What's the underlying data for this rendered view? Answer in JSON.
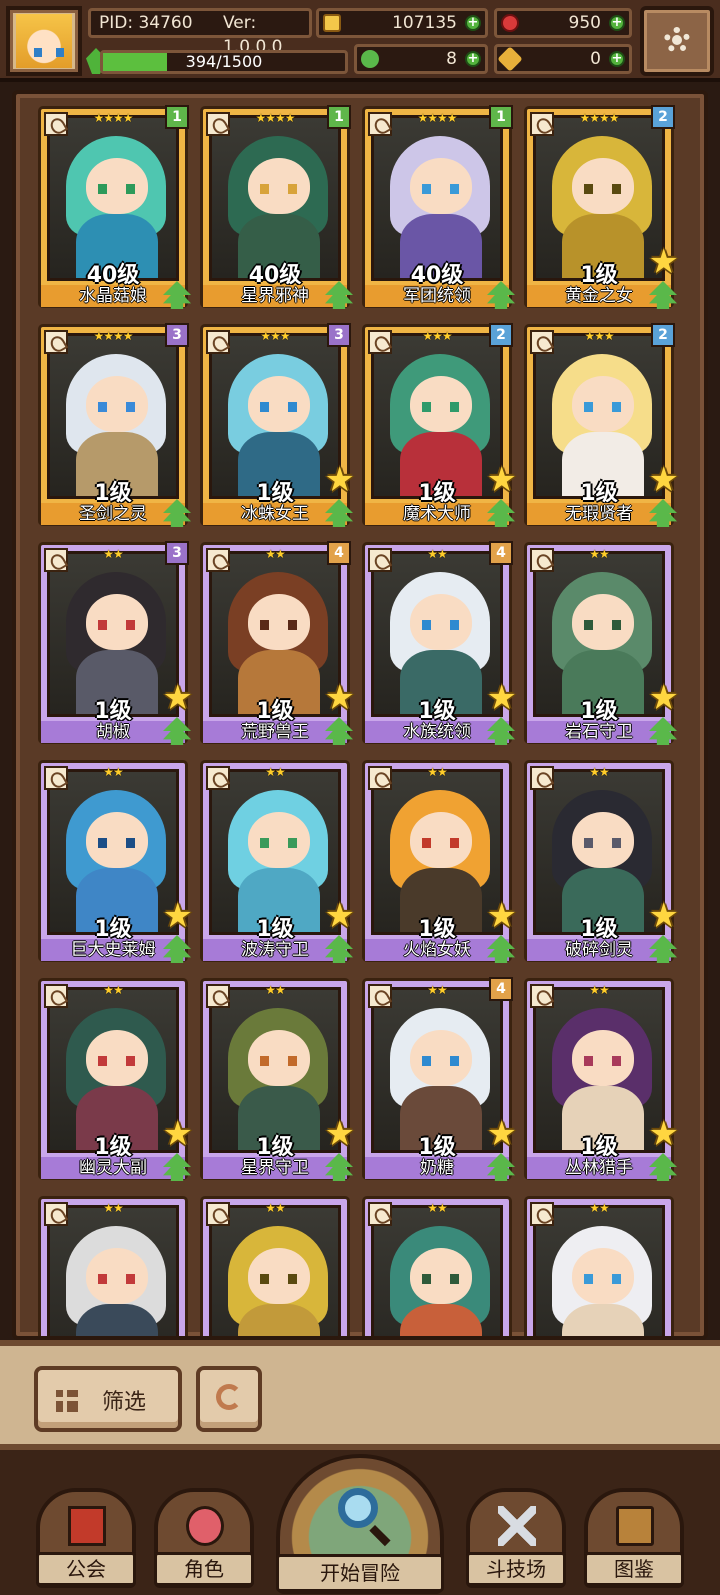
{
  "player": {
    "pid": "PID: 34760",
    "version": "Ver: 1.0.0.0",
    "xp_text": "394/1500",
    "xp_progress": 0.263
  },
  "currencies": {
    "gold": "107135",
    "gems": "950",
    "clovers": "8",
    "keys": "0"
  },
  "colors": {
    "hud_bg": "#4a2d1e",
    "gold_card": "#f0b545",
    "purple_card": "#c9a6ea",
    "xp_fill": "#5cbf3e"
  },
  "cards": [
    {
      "name": "水晶菇娘",
      "level": "40级",
      "stars": "★★★★",
      "rank": "1",
      "rarity": "gold",
      "star_badge": false,
      "hair": "#4fc6b0",
      "body": "#2d8fb3",
      "eye": "#2d9a5a"
    },
    {
      "name": "星界邪神",
      "level": "40级",
      "stars": "★★★★",
      "rank": "1",
      "rarity": "gold",
      "star_badge": false,
      "hair": "#2d6a52",
      "body": "#355e48",
      "eye": "#d8a33a"
    },
    {
      "name": "军团统领",
      "level": "40级",
      "stars": "★★★★",
      "rank": "1",
      "rarity": "gold",
      "star_badge": false,
      "hair": "#cdc6e8",
      "body": "#6a56a6",
      "eye": "#3a9ad8"
    },
    {
      "name": "黄金之女",
      "level": "1级",
      "stars": "★★★★",
      "rank": "2",
      "rarity": "gold",
      "star_badge": true,
      "hair": "#d8b63a",
      "body": "#b8922a",
      "eye": "#5a4a10"
    },
    {
      "name": "圣剑之灵",
      "level": "1级",
      "stars": "★★★★",
      "rank": "3",
      "rarity": "gold",
      "star_badge": false,
      "hair": "#dfe6ee",
      "body": "#b69a6a",
      "eye": "#3a8ad8"
    },
    {
      "name": "冰蛛女王",
      "level": "1级",
      "stars": "★★★",
      "rank": "3",
      "rarity": "gold",
      "star_badge": true,
      "hair": "#79cde0",
      "body": "#2f6a86",
      "eye": "#2f8ad0"
    },
    {
      "name": "魔术大师",
      "level": "1级",
      "stars": "★★★",
      "rank": "2",
      "rarity": "gold",
      "star_badge": true,
      "hair": "#3f9a7a",
      "body": "#b8303a",
      "eye": "#2f9a6a"
    },
    {
      "name": "无瑕贤者",
      "level": "1级",
      "stars": "★★★",
      "rank": "2",
      "rarity": "gold",
      "star_badge": true,
      "hair": "#f6dd8a",
      "body": "#f2ece6",
      "eye": "#3a9ad8"
    },
    {
      "name": "胡椒",
      "level": "1级",
      "stars": "★★",
      "rank": "3",
      "rarity": "purple",
      "star_badge": true,
      "hair": "#2f2a2e",
      "body": "#595a68",
      "eye": "#c23a3a"
    },
    {
      "name": "荒野兽王",
      "level": "1级",
      "stars": "★★",
      "rank": "4",
      "rarity": "purple",
      "star_badge": true,
      "hair": "#7a3f24",
      "body": "#b6783a",
      "eye": "#5a2a18"
    },
    {
      "name": "水族统领",
      "level": "1级",
      "stars": "★★",
      "rank": "4",
      "rarity": "purple",
      "star_badge": true,
      "hair": "#e6ecf2",
      "body": "#3a6a66",
      "eye": "#2f8ad0"
    },
    {
      "name": "岩石守卫",
      "level": "1级",
      "stars": "★★",
      "rank": "",
      "rarity": "purple",
      "star_badge": true,
      "hair": "#5a8a6a",
      "body": "#4a7a5a",
      "eye": "#2f5a3a"
    },
    {
      "name": "巨大史莱姆",
      "level": "1级",
      "stars": "★★",
      "rank": "",
      "rarity": "purple",
      "star_badge": true,
      "hair": "#3f9ad0",
      "body": "#3f86c6",
      "eye": "#1c4e86"
    },
    {
      "name": "波涛守卫",
      "level": "1级",
      "stars": "★★",
      "rank": "",
      "rarity": "purple",
      "star_badge": true,
      "hair": "#6fd0e2",
      "body": "#4fa8c4",
      "eye": "#3a9a5a"
    },
    {
      "name": "火焰女妖",
      "level": "1级",
      "stars": "★★",
      "rank": "",
      "rarity": "purple",
      "star_badge": true,
      "hair": "#f0a232",
      "body": "#4a3a2a",
      "eye": "#c23a2a"
    },
    {
      "name": "破碎剑灵",
      "level": "1级",
      "stars": "★★",
      "rank": "",
      "rarity": "purple",
      "star_badge": true,
      "hair": "#2a2a32",
      "body": "#3a6a5a",
      "eye": "#5a5a6a"
    },
    {
      "name": "幽灵大副",
      "level": "1级",
      "stars": "★★",
      "rank": "",
      "rarity": "purple",
      "star_badge": true,
      "hair": "#2f5a4e",
      "body": "#7a3a4a",
      "eye": "#c23a3a"
    },
    {
      "name": "星界守卫",
      "level": "1级",
      "stars": "★★",
      "rank": "",
      "rarity": "purple",
      "star_badge": true,
      "hair": "#6a7a3a",
      "body": "#3a5a4a",
      "eye": "#c26a2a"
    },
    {
      "name": "奶糖",
      "level": "1级",
      "stars": "★★",
      "rank": "4",
      "rarity": "purple",
      "star_badge": true,
      "hair": "#e6ecf2",
      "body": "#6a4a3a",
      "eye": "#2f8ad0"
    },
    {
      "name": "丛林猎手",
      "level": "1级",
      "stars": "★★",
      "rank": "",
      "rarity": "purple",
      "star_badge": true,
      "hair": "#5a2f6a",
      "body": "#e6d2b8",
      "eye": "#a83a5a"
    },
    {
      "name": "",
      "level": "",
      "stars": "★★",
      "rank": "",
      "rarity": "purple",
      "star_badge": false,
      "hair": "#dcdcdc",
      "body": "#3a4a5a",
      "eye": "#c23a3a"
    },
    {
      "name": "",
      "level": "",
      "stars": "★★",
      "rank": "",
      "rarity": "purple",
      "star_badge": false,
      "hair": "#d8b63a",
      "body": "#c29a3a",
      "eye": "#5a4a10"
    },
    {
      "name": "",
      "level": "",
      "stars": "★★",
      "rank": "",
      "rarity": "purple",
      "star_badge": false,
      "hair": "#3a8a7a",
      "body": "#c8603a",
      "eye": "#2f5a3a"
    },
    {
      "name": "",
      "level": "",
      "stars": "★★",
      "rank": "",
      "rarity": "purple",
      "star_badge": false,
      "hair": "#eeeef2",
      "body": "#e6d2b8",
      "eye": "#3a9ad8"
    }
  ],
  "toolbar": {
    "filter_label": "筛选"
  },
  "nav": {
    "guild": "公会",
    "characters": "角色",
    "start_adventure": "开始冒险",
    "arena": "斗技场",
    "codex": "图鉴"
  }
}
